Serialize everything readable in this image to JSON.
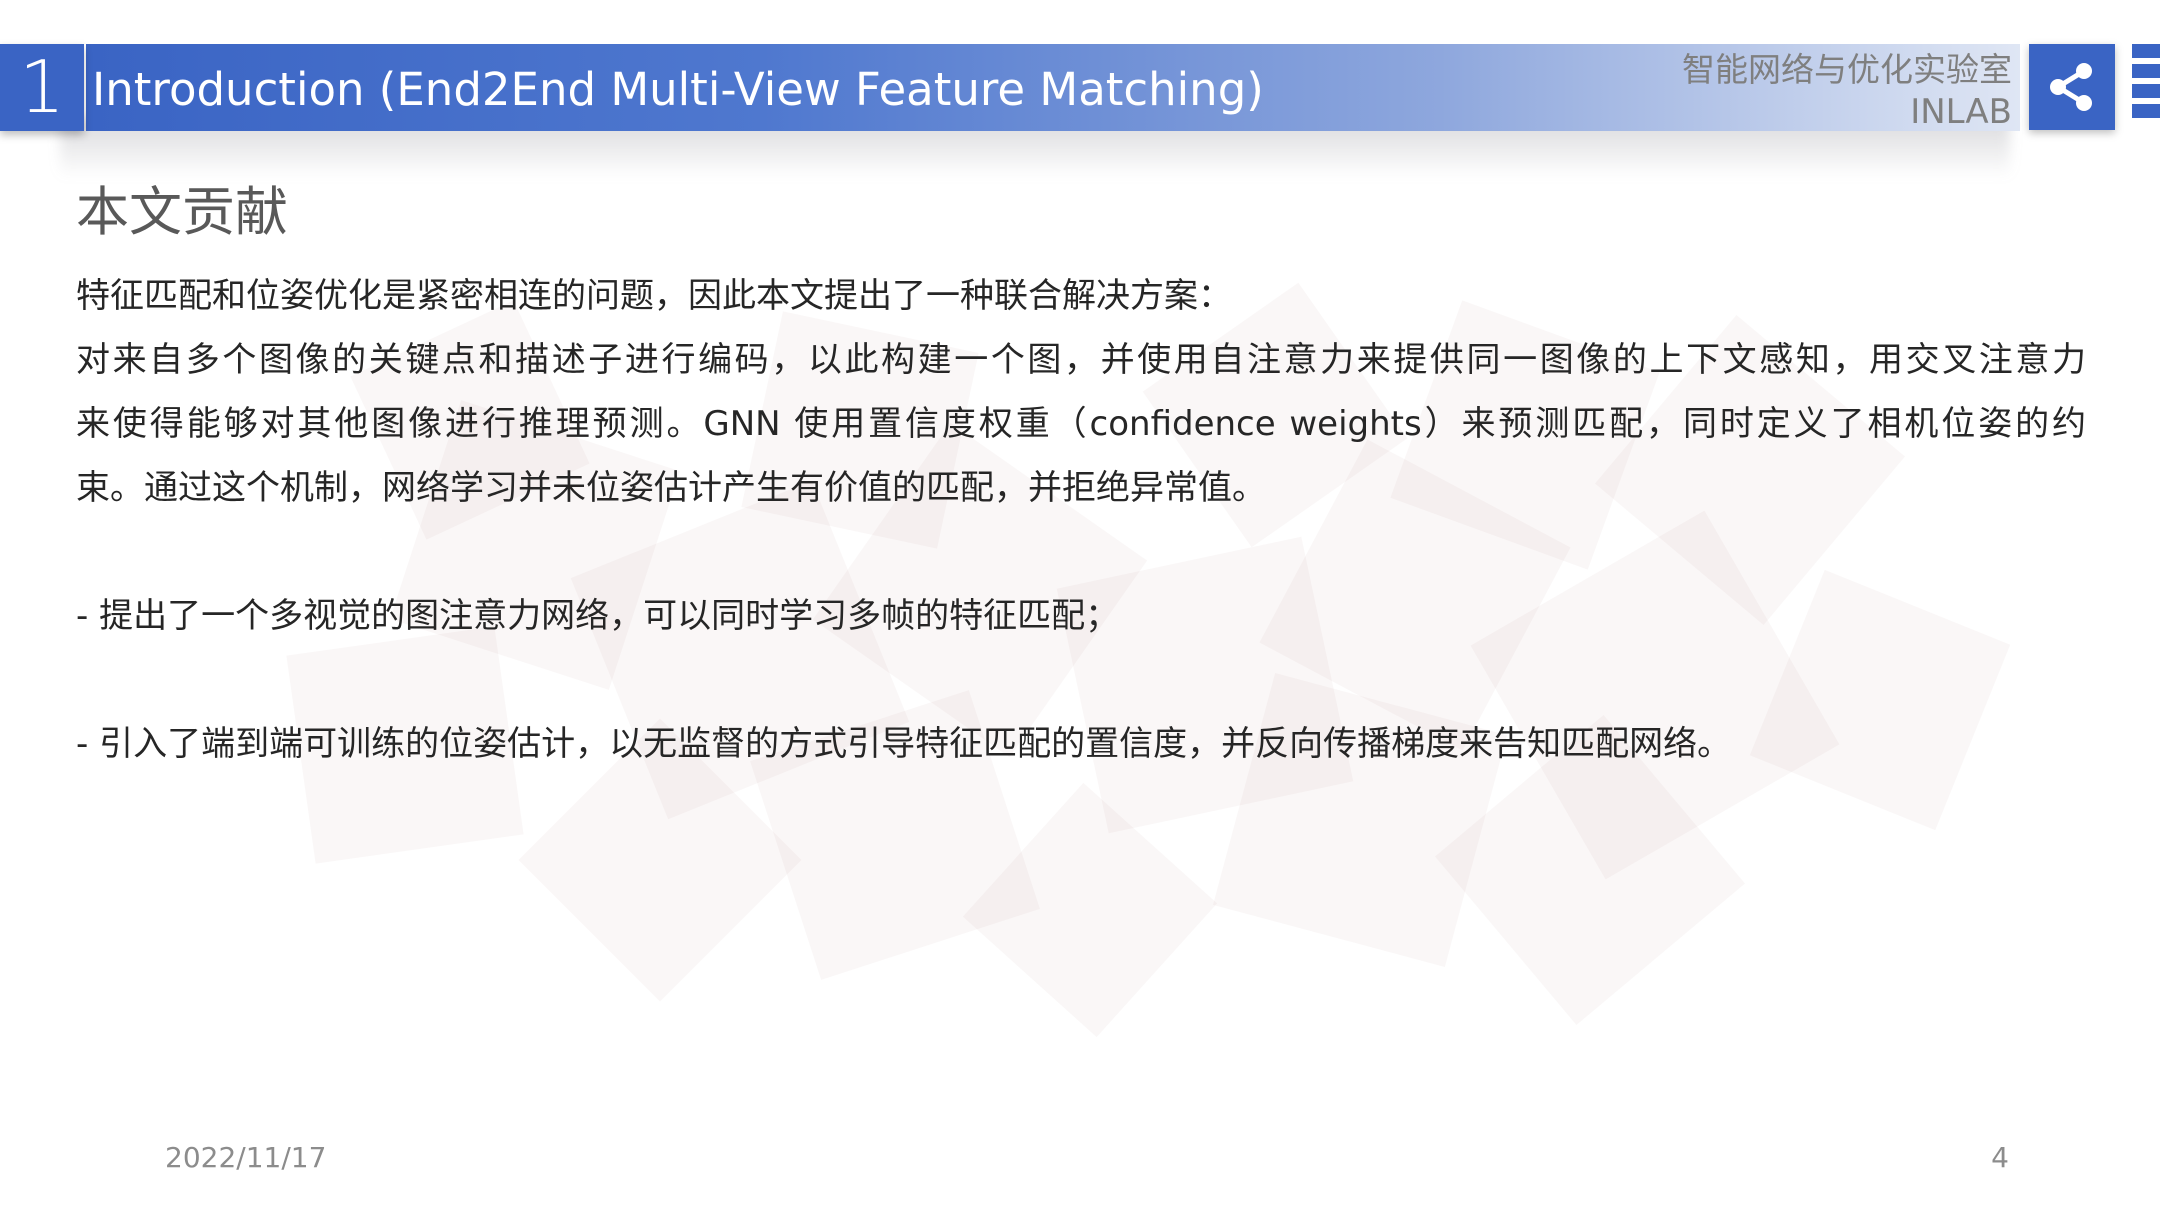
{
  "header": {
    "section_number": "1",
    "title": "Introduction (End2End Multi-View Feature Matching)",
    "lab_name": "智能网络与优化实验室",
    "lab_abbr": "INLAB",
    "share_icon": "share-icon"
  },
  "content": {
    "heading": "本文贡献",
    "intro_line": "特征匹配和位姿优化是紧密相连的问题，因此本文提出了一种联合解决方案：",
    "paragraph_lines": [
      "对来自多个图像的关键点和描述子进行编码，以此构建一个图，并使用自注意力来提供同一图像的上下文感知，用交叉注意力",
      "来使得能够对其他图像进行推理预测。GNN 使用置信度权重（confidence weights）来预测匹配，同时定义了相机位姿的约",
      "束。通过这个机制，网络学习并未位姿估计产生有价值的匹配，并拒绝异常值。"
    ],
    "bullets": [
      "- 提出了一个多视觉的图注意力网络，可以同时学习多帧的特征匹配；",
      "- 引入了端到端可训练的位姿估计，以无监督的方式引导特征匹配的置信度，并反向传播梯度来告知匹配网络。"
    ]
  },
  "footer": {
    "date": "2022/11/17",
    "page_number": "4"
  },
  "colors": {
    "accent_blue": "#3a64c4",
    "heading_gray": "#595959",
    "body_text": "#262626",
    "footer_gray": "#8c8c8c",
    "decor_pink": "#c9a9a9"
  }
}
